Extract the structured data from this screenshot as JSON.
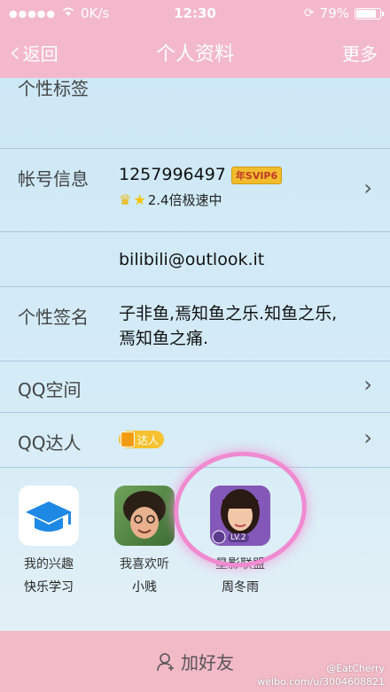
{
  "status_bar": {
    "signal": "●●●●●",
    "carrier_speed": "0K/s",
    "time": "12:30",
    "battery": "79%",
    "battery_level": 0.79
  },
  "nav": {
    "back_label": "返回",
    "title": "个人资料",
    "more_label": "更多"
  },
  "rows": {
    "tag_label": "个性标签",
    "account_label": "帐号信息",
    "account_id": "1257996497",
    "svip_badge": "年SVIP6",
    "speed_text": "2.4倍极速中",
    "email": "bilibili@outlook.it",
    "signature_label": "个性签名",
    "signature": "子非鱼,焉知鱼之乐.知鱼之乐,焉知鱼之痛.",
    "qzone_label": "QQ空间",
    "daren_label": "QQ达人",
    "daren_badge": "达人"
  },
  "apps": [
    {
      "title": "我的兴趣",
      "subtitle": "快乐学习"
    },
    {
      "title": "我喜欢听",
      "subtitle": "小贱"
    },
    {
      "title": "星影联盟",
      "subtitle": "周冬雨",
      "badge": "LV.2"
    }
  ],
  "bottom": {
    "add_friend": "加好友"
  },
  "watermark": {
    "line1": "@EatCherry",
    "line2": "weibo.com/u/3004608821"
  },
  "colors": {
    "pink_bar": "#f3b8cc",
    "accent_circle": "#f08ad1",
    "content_bg": "#cde8f6"
  }
}
